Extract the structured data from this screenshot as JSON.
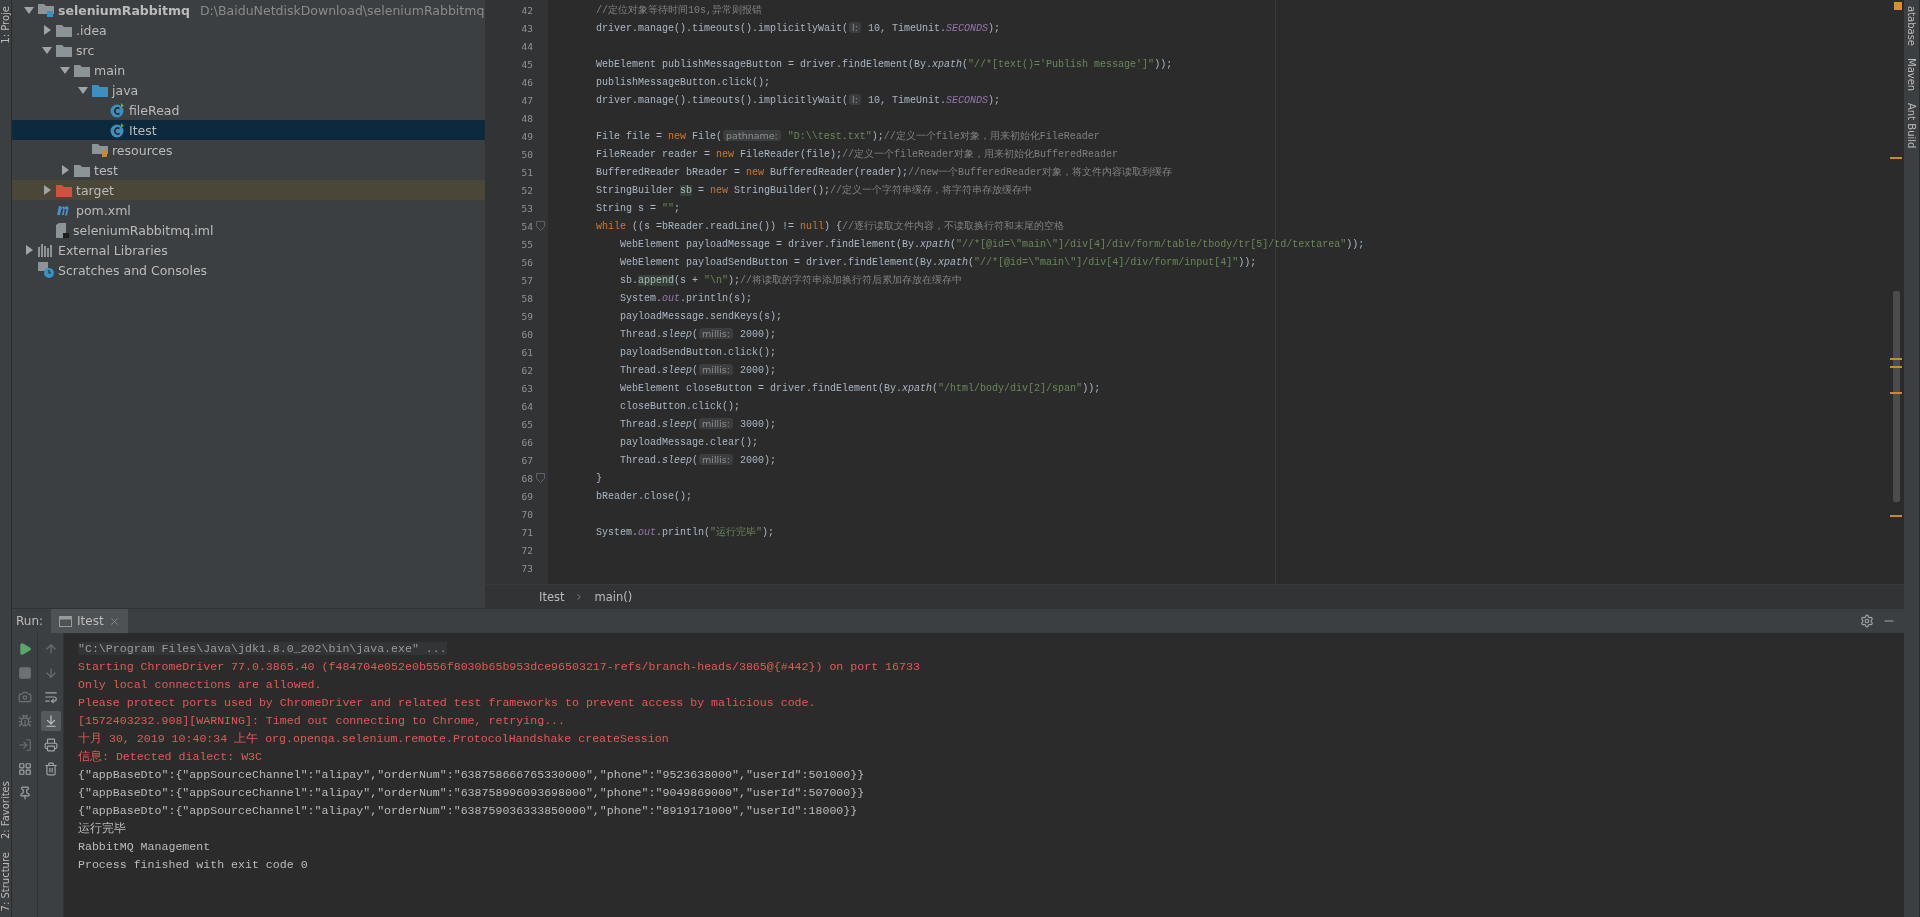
{
  "left_strip": [
    {
      "label": "1: Proje"
    },
    {
      "label": "2: Favorites"
    },
    {
      "label": "7: Structure"
    }
  ],
  "right_strip": [
    {
      "label": "atabase"
    },
    {
      "label": "Maven"
    },
    {
      "label": "Ant Build"
    }
  ],
  "project_tree": [
    {
      "label": "seleniumRabbitmq",
      "path": "D:\\BaiduNetdiskDownload\\seleniumRabbitmq",
      "kind": "module",
      "expanded": true,
      "selected": false,
      "children": [
        {
          "label": ".idea",
          "kind": "folder",
          "expanded": false,
          "selected": false
        },
        {
          "label": "src",
          "kind": "folder",
          "expanded": true,
          "selected": false,
          "children": [
            {
              "label": "main",
              "kind": "folder",
              "expanded": true,
              "selected": false,
              "children": [
                {
                  "label": "java",
                  "kind": "source-root",
                  "expanded": true,
                  "selected": false,
                  "children": [
                    {
                      "label": "fileRead",
                      "kind": "class",
                      "selected": false
                    },
                    {
                      "label": "Itest",
                      "kind": "class",
                      "selected": true
                    }
                  ]
                },
                {
                  "label": "resources",
                  "kind": "resources",
                  "selected": false
                }
              ]
            },
            {
              "label": "test",
              "kind": "folder",
              "expanded": false,
              "selected": false
            }
          ]
        },
        {
          "label": "target",
          "kind": "excluded",
          "expanded": false,
          "selected": false
        },
        {
          "label": "pom.xml",
          "kind": "maven",
          "selected": false
        },
        {
          "label": "seleniumRabbitmq.iml",
          "kind": "iml",
          "selected": false
        }
      ]
    },
    {
      "label": "External Libraries",
      "kind": "libraries",
      "expanded": false,
      "selected": false
    },
    {
      "label": "Scratches and Consoles",
      "kind": "scratches",
      "selected": false
    }
  ],
  "editor": {
    "lines": [
      {
        "number": "42",
        "segments": [
          {
            "kind": "comment",
            "text": "        //定位对象等待时间10s,异常则报错"
          }
        ]
      },
      {
        "number": "43",
        "segments": [
          {
            "kind": "plain",
            "text": "        driver.manage().timeouts().implicitlyWait("
          },
          {
            "kind": "hint",
            "text": "l:"
          },
          {
            "kind": "plain",
            "text": " 10, TimeUnit."
          },
          {
            "kind": "static",
            "text": "SECONDS"
          },
          {
            "kind": "plain",
            "text": ");"
          }
        ]
      },
      {
        "number": "44"
      },
      {
        "number": "45",
        "segments": [
          {
            "kind": "plain",
            "text": "        WebElement publishMessageButton = driver.findElement(By."
          },
          {
            "kind": "italic",
            "text": "xpath"
          },
          {
            "kind": "plain",
            "text": "("
          },
          {
            "kind": "string",
            "text": "\"//*[text()='Publish message']\""
          },
          {
            "kind": "plain",
            "text": "));"
          }
        ]
      },
      {
        "number": "46",
        "segments": [
          {
            "kind": "plain",
            "text": "        publishMessageButton.click();"
          }
        ]
      },
      {
        "number": "47",
        "segments": [
          {
            "kind": "plain",
            "text": "        driver.manage().timeouts().implicitlyWait("
          },
          {
            "kind": "hint",
            "text": "l:"
          },
          {
            "kind": "plain",
            "text": " 10, TimeUnit."
          },
          {
            "kind": "static",
            "text": "SECONDS"
          },
          {
            "kind": "plain",
            "text": ");"
          }
        ]
      },
      {
        "number": "48"
      },
      {
        "number": "49",
        "segments": [
          {
            "kind": "plain",
            "text": "        File file = "
          },
          {
            "kind": "keyword",
            "text": "new"
          },
          {
            "kind": "plain",
            "text": " File("
          },
          {
            "kind": "hint",
            "text": "pathname:"
          },
          {
            "kind": "string",
            "text": " \"D:\\\\test.txt\""
          },
          {
            "kind": "plain",
            "text": ");"
          },
          {
            "kind": "comment",
            "text": "//定义一个file对象，用来初始化FileReader"
          }
        ]
      },
      {
        "number": "50",
        "segments": [
          {
            "kind": "plain",
            "text": "        FileReader reader = "
          },
          {
            "kind": "keyword",
            "text": "new"
          },
          {
            "kind": "plain",
            "text": " FileReader(file);"
          },
          {
            "kind": "comment",
            "text": "//定义一个fileReader对象，用来初始化BufferedReader"
          }
        ]
      },
      {
        "number": "51",
        "segments": [
          {
            "kind": "plain",
            "text": "        BufferedReader bReader = "
          },
          {
            "kind": "keyword",
            "text": "new"
          },
          {
            "kind": "plain",
            "text": " BufferedReader(reader);"
          },
          {
            "kind": "comment",
            "text": "//new一个BufferedReader对象，将文件内容读取到缓存"
          }
        ]
      },
      {
        "number": "52",
        "segments": [
          {
            "kind": "plain",
            "text": "        StringBuilder "
          },
          {
            "kind": "highlight",
            "text": "sb"
          },
          {
            "kind": "plain",
            "text": " = "
          },
          {
            "kind": "keyword",
            "text": "new"
          },
          {
            "kind": "plain",
            "text": " StringBuilder();"
          },
          {
            "kind": "comment",
            "text": "//定义一个字符串缓存，将字符串存放缓存中"
          }
        ]
      },
      {
        "number": "53",
        "segments": [
          {
            "kind": "plain",
            "text": "        String s = "
          },
          {
            "kind": "string",
            "text": "\"\""
          },
          {
            "kind": "plain",
            "text": ";"
          }
        ]
      },
      {
        "number": "54",
        "fold": true,
        "segments": [
          {
            "kind": "keyword",
            "text": "        while"
          },
          {
            "kind": "plain",
            "text": " ((s =bReader.readLine()) != "
          },
          {
            "kind": "keyword",
            "text": "null"
          },
          {
            "kind": "plain",
            "text": ") {"
          },
          {
            "kind": "comment",
            "text": "//逐行读取文件内容，不读取换行符和末尾的空格"
          }
        ]
      },
      {
        "number": "55",
        "segments": [
          {
            "kind": "plain",
            "text": "            WebElement payloadMessage = driver.findElement(By."
          },
          {
            "kind": "italic",
            "text": "xpath"
          },
          {
            "kind": "plain",
            "text": "("
          },
          {
            "kind": "string",
            "text": "\"//*[@id=\\\"main\\\"]/div[4]/div/form/table/tbody/tr[5]/td/textarea\""
          },
          {
            "kind": "plain",
            "text": "));"
          }
        ]
      },
      {
        "number": "56",
        "segments": [
          {
            "kind": "plain",
            "text": "            WebElement payloadSendButton = driver.findElement(By."
          },
          {
            "kind": "italic",
            "text": "xpath"
          },
          {
            "kind": "plain",
            "text": "("
          },
          {
            "kind": "string",
            "text": "\"//*[@id=\\\"main\\\"]/div[4]/div/form/input[4]\""
          },
          {
            "kind": "plain",
            "text": "));"
          }
        ]
      },
      {
        "number": "57",
        "segments": [
          {
            "kind": "plain",
            "text": "            sb."
          },
          {
            "kind": "highlight",
            "text": "append"
          },
          {
            "kind": "plain",
            "text": "(s + "
          },
          {
            "kind": "string",
            "text": "\"\\n\""
          },
          {
            "kind": "plain",
            "text": ");"
          },
          {
            "kind": "comment",
            "text": "//将读取的字符串添加换行符后累加存放在缓存中"
          }
        ]
      },
      {
        "number": "58",
        "segments": [
          {
            "kind": "plain",
            "text": "            System."
          },
          {
            "kind": "static",
            "text": "out"
          },
          {
            "kind": "plain",
            "text": ".println(s);"
          }
        ]
      },
      {
        "number": "59",
        "segments": [
          {
            "kind": "plain",
            "text": "            payloadMessage.sendKeys(s);"
          }
        ]
      },
      {
        "number": "60",
        "segments": [
          {
            "kind": "plain",
            "text": "            Thread."
          },
          {
            "kind": "italic",
            "text": "sleep"
          },
          {
            "kind": "plain",
            "text": "("
          },
          {
            "kind": "hint",
            "text": "millis:"
          },
          {
            "kind": "plain",
            "text": " 2000);"
          }
        ]
      },
      {
        "number": "61",
        "segments": [
          {
            "kind": "plain",
            "text": "            payloadSendButton.click();"
          }
        ]
      },
      {
        "number": "62",
        "segments": [
          {
            "kind": "plain",
            "text": "            Thread."
          },
          {
            "kind": "italic",
            "text": "sleep"
          },
          {
            "kind": "plain",
            "text": "("
          },
          {
            "kind": "hint",
            "text": "millis:"
          },
          {
            "kind": "plain",
            "text": " 2000);"
          }
        ]
      },
      {
        "number": "63",
        "segments": [
          {
            "kind": "plain",
            "text": "            WebElement closeButton = driver.findElement(By."
          },
          {
            "kind": "italic",
            "text": "xpath"
          },
          {
            "kind": "plain",
            "text": "("
          },
          {
            "kind": "string",
            "text": "\"/html/body/div[2]/span\""
          },
          {
            "kind": "plain",
            "text": "));"
          }
        ]
      },
      {
        "number": "64",
        "segments": [
          {
            "kind": "plain",
            "text": "            closeButton.click();"
          }
        ]
      },
      {
        "number": "65",
        "segments": [
          {
            "kind": "plain",
            "text": "            Thread."
          },
          {
            "kind": "italic",
            "text": "sleep"
          },
          {
            "kind": "plain",
            "text": "("
          },
          {
            "kind": "hint",
            "text": "millis:"
          },
          {
            "kind": "plain",
            "text": " 3000);"
          }
        ]
      },
      {
        "number": "66",
        "segments": [
          {
            "kind": "plain",
            "text": "            payloadMessage.clear();"
          }
        ]
      },
      {
        "number": "67",
        "segments": [
          {
            "kind": "plain",
            "text": "            Thread."
          },
          {
            "kind": "italic",
            "text": "sleep"
          },
          {
            "kind": "plain",
            "text": "("
          },
          {
            "kind": "hint",
            "text": "millis:"
          },
          {
            "kind": "plain",
            "text": " 2000);"
          }
        ]
      },
      {
        "number": "68",
        "fold": true,
        "segments": [
          {
            "kind": "plain",
            "text": "        }"
          }
        ]
      },
      {
        "number": "69",
        "segments": [
          {
            "kind": "plain",
            "text": "        bReader.close();"
          }
        ]
      },
      {
        "number": "70"
      },
      {
        "number": "71",
        "segments": [
          {
            "kind": "plain",
            "text": "        System."
          },
          {
            "kind": "static",
            "text": "out"
          },
          {
            "kind": "plain",
            "text": ".println("
          },
          {
            "kind": "string",
            "text": "\"运行完毕\""
          },
          {
            "kind": "plain",
            "text": ");"
          }
        ]
      },
      {
        "number": "72"
      },
      {
        "number": "73"
      }
    ],
    "breadcrumbs": [
      "Itest",
      "main()"
    ]
  },
  "run_panel": {
    "label": "Run:",
    "tabs": [
      {
        "label": "Itest",
        "selected": true
      }
    ],
    "console": [
      {
        "kind": "command",
        "text": "\"C:\\Program Files\\Java\\jdk1.8.0_202\\bin\\java.exe\" ..."
      },
      {
        "kind": "error",
        "text": "Starting ChromeDriver 77.0.3865.40 (f484704e052e0b556f8030b65b953dce96503217-refs/branch-heads/3865@{#442}) on port 16733"
      },
      {
        "kind": "error",
        "text": "Only local connections are allowed."
      },
      {
        "kind": "error",
        "text": "Please protect ports used by ChromeDriver and related test frameworks to prevent access by malicious code."
      },
      {
        "kind": "error",
        "text": "[1572403232.908][WARNING]: Timed out connecting to Chrome, retrying..."
      },
      {
        "kind": "error",
        "text": "十月 30, 2019 10:40:34 上午 org.openqa.selenium.remote.ProtocolHandshake createSession"
      },
      {
        "kind": "error",
        "text": "信息: Detected dialect: W3C"
      },
      {
        "kind": "output",
        "text": "{\"appBaseDto\":{\"appSourceChannel\":\"alipay\",\"orderNum\":\"638758666765330000\",\"phone\":\"9523638000\",\"userId\":501000}}"
      },
      {
        "kind": "output",
        "text": "{\"appBaseDto\":{\"appSourceChannel\":\"alipay\",\"orderNum\":\"638758996093698000\",\"phone\":\"9049869000\",\"userId\":507000}}"
      },
      {
        "kind": "output",
        "text": "{\"appBaseDto\":{\"appSourceChannel\":\"alipay\",\"orderNum\":\"638759036333850000\",\"phone\":\"8919171000\",\"userId\":18000}}"
      },
      {
        "kind": "output",
        "text": "运行完毕"
      },
      {
        "kind": "output",
        "text": "RabbitMQ Management"
      },
      {
        "kind": "output",
        "text": "Process finished with exit code 0"
      }
    ]
  }
}
